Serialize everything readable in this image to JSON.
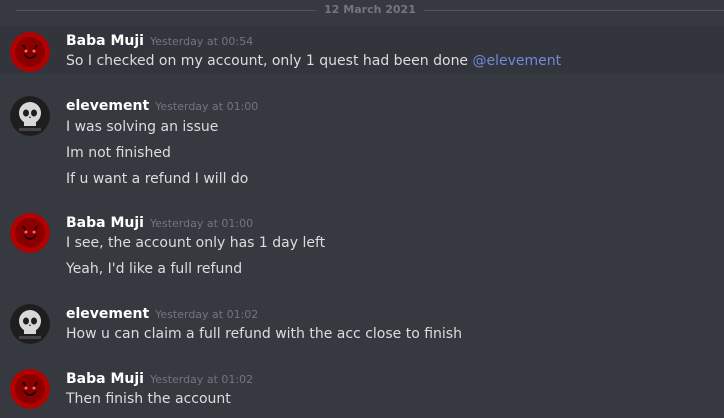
{
  "date_divider": "12 March 2021",
  "colors": {
    "background": "#36393f",
    "username": "#ffffff",
    "message_text": "#dcddde",
    "timestamp": "#72767d",
    "mention": "#7289da",
    "highlight_background": "#32353b",
    "divider_line": "#4f545c",
    "red_avatar": "#b30000",
    "dark_avatar": "#1e1e1e"
  },
  "messages": [
    {
      "username": "Baba Muji",
      "timestamp": "Yesterday at 00:54",
      "avatar": "red-demon-avatar",
      "lines": [
        "So I checked on my account, only 1 quest had been done "
      ],
      "mention": "@elevement"
    },
    {
      "username": "elevement",
      "timestamp": "Yesterday at 01:00",
      "avatar": "skull-avatar",
      "lines": [
        "I was solving an issue",
        "Im not finished",
        "If u want a refund I will do"
      ]
    },
    {
      "username": "Baba Muji",
      "timestamp": "Yesterday at 01:00",
      "avatar": "red-demon-avatar",
      "lines": [
        "I see, the account only has 1 day left",
        "Yeah, I'd like a full refund"
      ]
    },
    {
      "username": "elevement",
      "timestamp": "Yesterday at 01:02",
      "avatar": "skull-avatar",
      "lines": [
        "How u can claim a full refund with the acc close to finish"
      ]
    },
    {
      "username": "Baba Muji",
      "timestamp": "Yesterday at 01:02",
      "avatar": "red-demon-avatar",
      "lines": [
        "Then finish the account"
      ]
    }
  ]
}
